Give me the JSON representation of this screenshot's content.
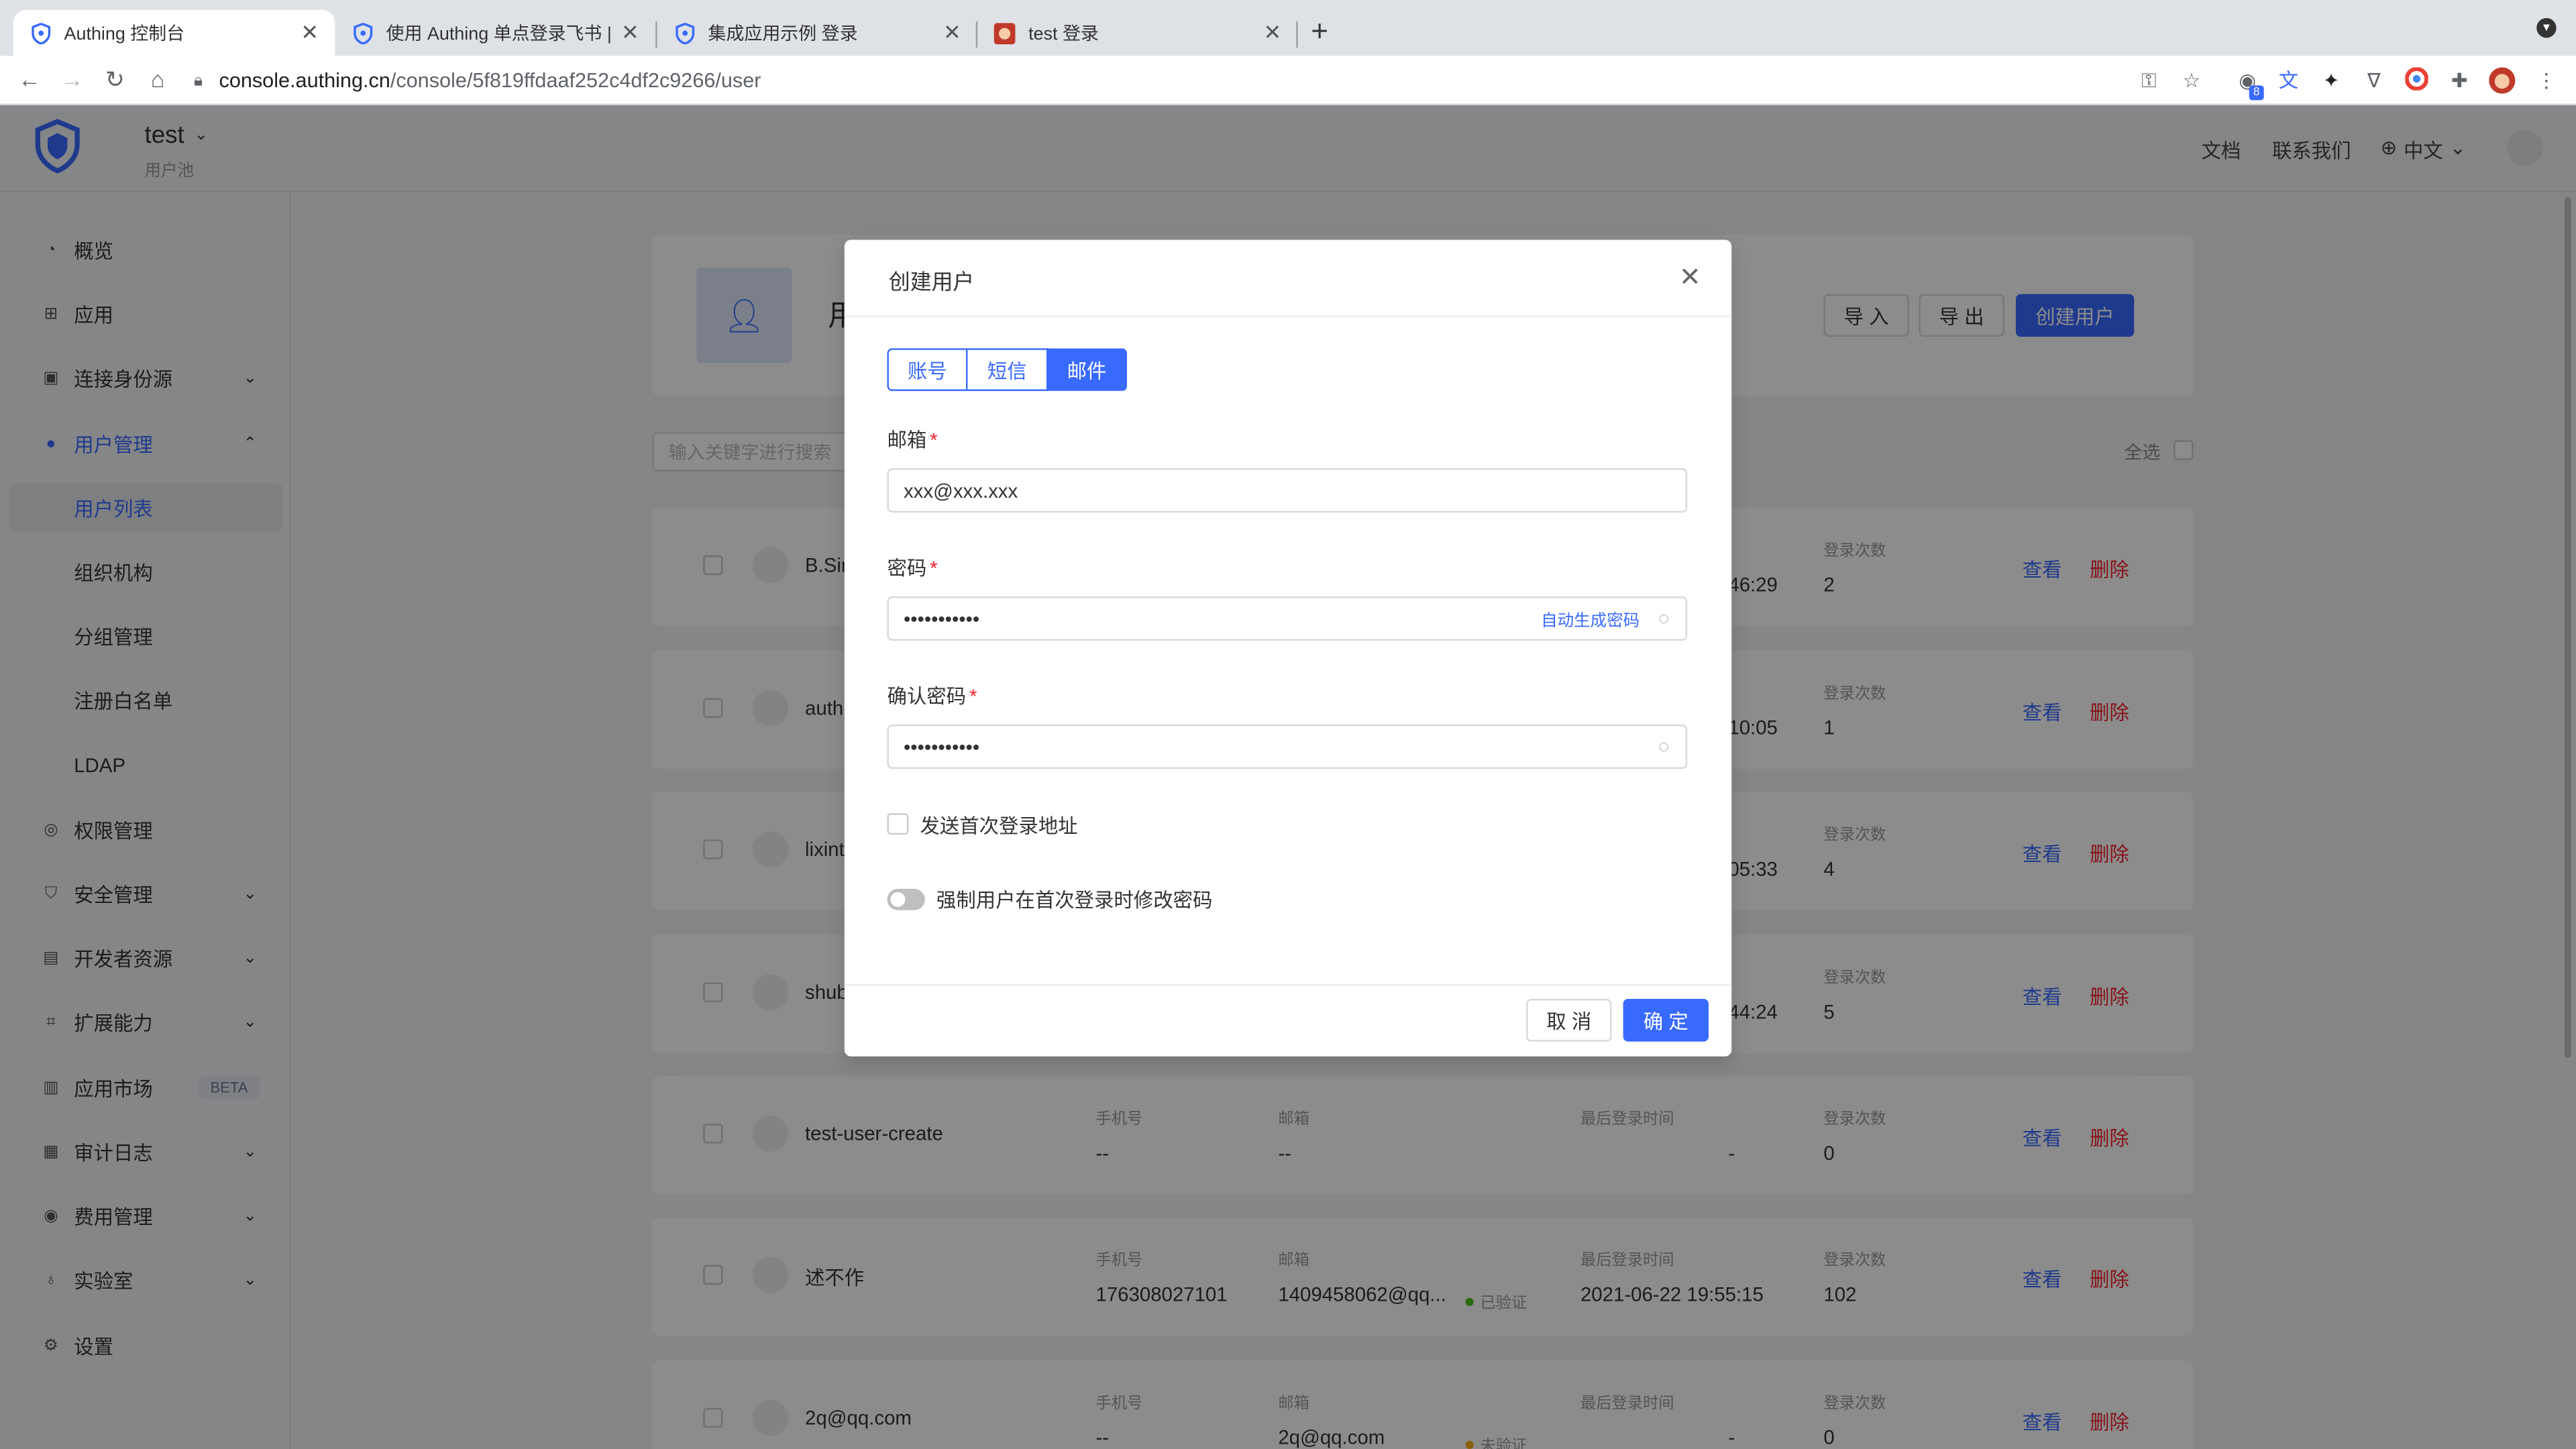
{
  "browser": {
    "tabs": [
      {
        "title": "Authing 控制台",
        "active": true
      },
      {
        "title": "使用 Authing 单点登录飞书 | Aut",
        "active": false
      },
      {
        "title": "集成应用示例 登录",
        "active": false
      },
      {
        "title": "test 登录",
        "active": false
      }
    ],
    "url_host": "console.authing.cn",
    "url_path": "/console/5f819ffdaaf252c4df2c9266/user",
    "ext_badge": "8"
  },
  "header": {
    "pool_name": "test",
    "pool_sub": "用户池",
    "links": {
      "docs": "文档",
      "contact": "联系我们",
      "lang": "中文"
    }
  },
  "sidebar": {
    "items": [
      {
        "label": "概览"
      },
      {
        "label": "应用"
      },
      {
        "label": "连接身份源"
      },
      {
        "label": "用户管理"
      },
      {
        "label": "用户列表"
      },
      {
        "label": "组织机构"
      },
      {
        "label": "分组管理"
      },
      {
        "label": "注册白名单"
      },
      {
        "label": "LDAP"
      },
      {
        "label": "权限管理"
      },
      {
        "label": "安全管理"
      },
      {
        "label": "开发者资源"
      },
      {
        "label": "扩展能力"
      },
      {
        "label": "应用市场"
      },
      {
        "label": "审计日志"
      },
      {
        "label": "费用管理"
      },
      {
        "label": "实验室"
      },
      {
        "label": "设置"
      }
    ],
    "beta": "BETA"
  },
  "page": {
    "title": "用",
    "import": "导 入",
    "export": "导 出",
    "create": "创建用户",
    "search_placeholder": "输入关键字进行搜索",
    "select_all": "全选",
    "col_phone": "手机号",
    "col_email": "邮箱",
    "col_last_login": "最后登录时间",
    "col_login_count": "登录次数",
    "view": "查看",
    "delete": "删除",
    "rows": [
      {
        "name": "B.Sir",
        "phone": "",
        "email": "",
        "status": "",
        "last_login": "46:29",
        "count": "2"
      },
      {
        "name": "auth",
        "phone": "",
        "email": "",
        "status": "",
        "last_login": "10:05",
        "count": "1"
      },
      {
        "name": "lixint",
        "phone": "",
        "email": "",
        "status": "",
        "last_login": "05:33",
        "count": "4"
      },
      {
        "name": "shub",
        "phone": "",
        "email": "",
        "status": "",
        "last_login": "44:24",
        "count": "5"
      },
      {
        "name": "test-user-create",
        "phone": "--",
        "email": "--",
        "status": "",
        "last_login": "-",
        "count": "0"
      },
      {
        "name": "述不作",
        "phone": "176308027101",
        "email": "1409458062@qq...",
        "status": "已验证",
        "last_login": "2021-06-22 19:55:15",
        "count": "102"
      },
      {
        "name": "2q@qq.com",
        "phone": "--",
        "email": "2q@qq.com",
        "status": "未验证",
        "last_login": "-",
        "count": "0"
      }
    ]
  },
  "modal": {
    "title": "创建用户",
    "tabs": [
      "账号",
      "短信",
      "邮件"
    ],
    "active_tab": 2,
    "email_label": "邮箱",
    "email_value": "xxx@xxx.xxx",
    "password_label": "密码",
    "password_value": "•••••••••••",
    "auto_gen": "自动生成密码",
    "confirm_label": "确认密码",
    "confirm_value": "•••••••••••",
    "send_first_login": "发送首次登录地址",
    "force_change": "强制用户在首次登录时修改密码",
    "cancel": "取 消",
    "ok": "确 定"
  },
  "colors": {
    "accent": "#396aff",
    "verified": "#52c41a",
    "unverified": "#faad14",
    "danger": "#f5222d"
  }
}
